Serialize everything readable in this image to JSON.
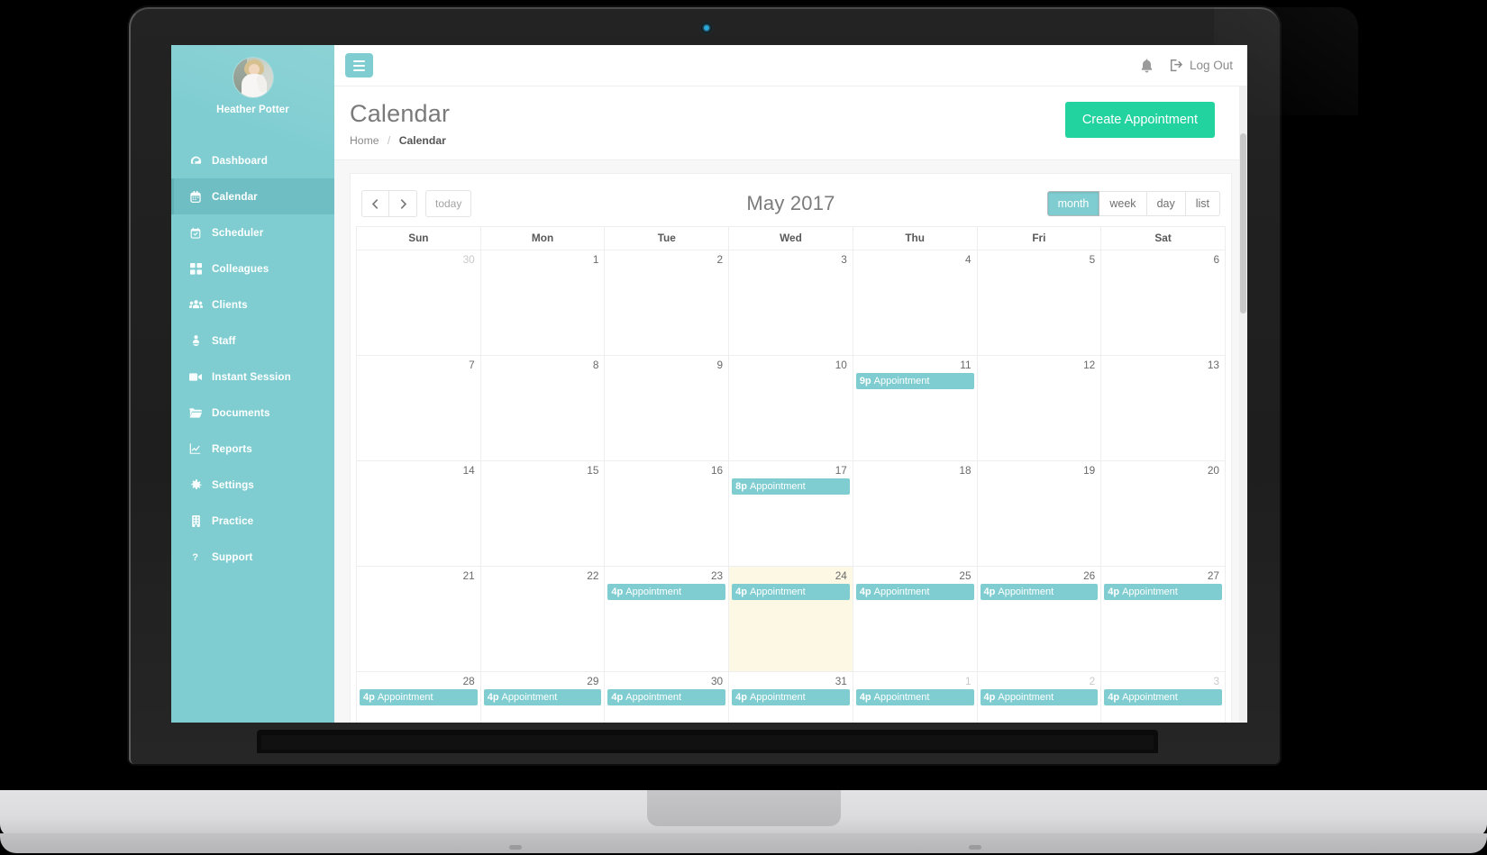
{
  "sidebar": {
    "profile": {
      "name": "Heather Potter",
      "avatar_icon": "user-avatar-photo"
    },
    "items": [
      {
        "label": "Dashboard",
        "icon": "dashboard-icon",
        "active": false
      },
      {
        "label": "Calendar",
        "icon": "calendar-icon",
        "active": true
      },
      {
        "label": "Scheduler",
        "icon": "scheduler-icon",
        "active": false
      },
      {
        "label": "Colleagues",
        "icon": "grid-icon",
        "active": false
      },
      {
        "label": "Clients",
        "icon": "users-icon",
        "active": false
      },
      {
        "label": "Staff",
        "icon": "staff-icon",
        "active": false
      },
      {
        "label": "Instant Session",
        "icon": "video-camera-icon",
        "active": false
      },
      {
        "label": "Documents",
        "icon": "folder-icon",
        "active": false
      },
      {
        "label": "Reports",
        "icon": "chart-line-icon",
        "active": false
      },
      {
        "label": "Settings",
        "icon": "gear-icon",
        "active": false
      },
      {
        "label": "Practice",
        "icon": "building-icon",
        "active": false
      },
      {
        "label": "Support",
        "icon": "question-mark-icon",
        "active": false
      }
    ]
  },
  "topbar": {
    "menu_toggle_icon": "hamburger-icon",
    "bell_icon": "bell-icon",
    "logout_icon": "sign-out-icon",
    "logout_label": "Log Out"
  },
  "pagehead": {
    "title": "Calendar",
    "breadcrumb_home": "Home",
    "breadcrumb_sep": "/",
    "breadcrumb_current": "Calendar",
    "create_button": "Create Appointment"
  },
  "calendar": {
    "prev_icon": "chevron-left-icon",
    "next_icon": "chevron-right-icon",
    "today_label": "today",
    "title": "May 2017",
    "views": [
      {
        "label": "month",
        "active": true
      },
      {
        "label": "week",
        "active": false
      },
      {
        "label": "day",
        "active": false
      },
      {
        "label": "list",
        "active": false
      }
    ],
    "weekdays": [
      "Sun",
      "Mon",
      "Tue",
      "Wed",
      "Thu",
      "Fri",
      "Sat"
    ],
    "weeks": [
      [
        {
          "num": "30",
          "other": true,
          "today": false,
          "events": []
        },
        {
          "num": "1",
          "other": false,
          "today": false,
          "events": []
        },
        {
          "num": "2",
          "other": false,
          "today": false,
          "events": []
        },
        {
          "num": "3",
          "other": false,
          "today": false,
          "events": []
        },
        {
          "num": "4",
          "other": false,
          "today": false,
          "events": []
        },
        {
          "num": "5",
          "other": false,
          "today": false,
          "events": []
        },
        {
          "num": "6",
          "other": false,
          "today": false,
          "events": []
        }
      ],
      [
        {
          "num": "7",
          "other": false,
          "today": false,
          "events": []
        },
        {
          "num": "8",
          "other": false,
          "today": false,
          "events": []
        },
        {
          "num": "9",
          "other": false,
          "today": false,
          "events": []
        },
        {
          "num": "10",
          "other": false,
          "today": false,
          "events": []
        },
        {
          "num": "11",
          "other": false,
          "today": false,
          "events": [
            {
              "time": "9p",
              "title": "Appointment"
            }
          ]
        },
        {
          "num": "12",
          "other": false,
          "today": false,
          "events": []
        },
        {
          "num": "13",
          "other": false,
          "today": false,
          "events": []
        }
      ],
      [
        {
          "num": "14",
          "other": false,
          "today": false,
          "events": []
        },
        {
          "num": "15",
          "other": false,
          "today": false,
          "events": []
        },
        {
          "num": "16",
          "other": false,
          "today": false,
          "events": []
        },
        {
          "num": "17",
          "other": false,
          "today": false,
          "events": [
            {
              "time": "8p",
              "title": "Appointment"
            }
          ]
        },
        {
          "num": "18",
          "other": false,
          "today": false,
          "events": []
        },
        {
          "num": "19",
          "other": false,
          "today": false,
          "events": []
        },
        {
          "num": "20",
          "other": false,
          "today": false,
          "events": []
        }
      ],
      [
        {
          "num": "21",
          "other": false,
          "today": false,
          "events": []
        },
        {
          "num": "22",
          "other": false,
          "today": false,
          "events": []
        },
        {
          "num": "23",
          "other": false,
          "today": false,
          "events": [
            {
              "time": "4p",
              "title": "Appointment"
            }
          ]
        },
        {
          "num": "24",
          "other": false,
          "today": true,
          "events": [
            {
              "time": "4p",
              "title": "Appointment"
            }
          ]
        },
        {
          "num": "25",
          "other": false,
          "today": false,
          "events": [
            {
              "time": "4p",
              "title": "Appointment"
            }
          ]
        },
        {
          "num": "26",
          "other": false,
          "today": false,
          "events": [
            {
              "time": "4p",
              "title": "Appointment"
            }
          ]
        },
        {
          "num": "27",
          "other": false,
          "today": false,
          "events": [
            {
              "time": "4p",
              "title": "Appointment"
            }
          ]
        }
      ],
      [
        {
          "num": "28",
          "other": false,
          "today": false,
          "events": [
            {
              "time": "4p",
              "title": "Appointment"
            }
          ]
        },
        {
          "num": "29",
          "other": false,
          "today": false,
          "events": [
            {
              "time": "4p",
              "title": "Appointment"
            }
          ]
        },
        {
          "num": "30",
          "other": false,
          "today": false,
          "events": [
            {
              "time": "4p",
              "title": "Appointment"
            }
          ]
        },
        {
          "num": "31",
          "other": false,
          "today": false,
          "events": [
            {
              "time": "4p",
              "title": "Appointment"
            }
          ]
        },
        {
          "num": "1",
          "other": true,
          "today": false,
          "events": [
            {
              "time": "4p",
              "title": "Appointment"
            }
          ]
        },
        {
          "num": "2",
          "other": true,
          "today": false,
          "events": [
            {
              "time": "4p",
              "title": "Appointment"
            }
          ]
        },
        {
          "num": "3",
          "other": true,
          "today": false,
          "events": [
            {
              "time": "4p",
              "title": "Appointment"
            }
          ]
        }
      ]
    ]
  },
  "colors": {
    "sidebar": "#7fcdd1",
    "sidebar_active": "#6fbec3",
    "accent_green": "#22d3a0",
    "event": "#7fcdd1",
    "today_highlight": "#fcf8e3"
  }
}
